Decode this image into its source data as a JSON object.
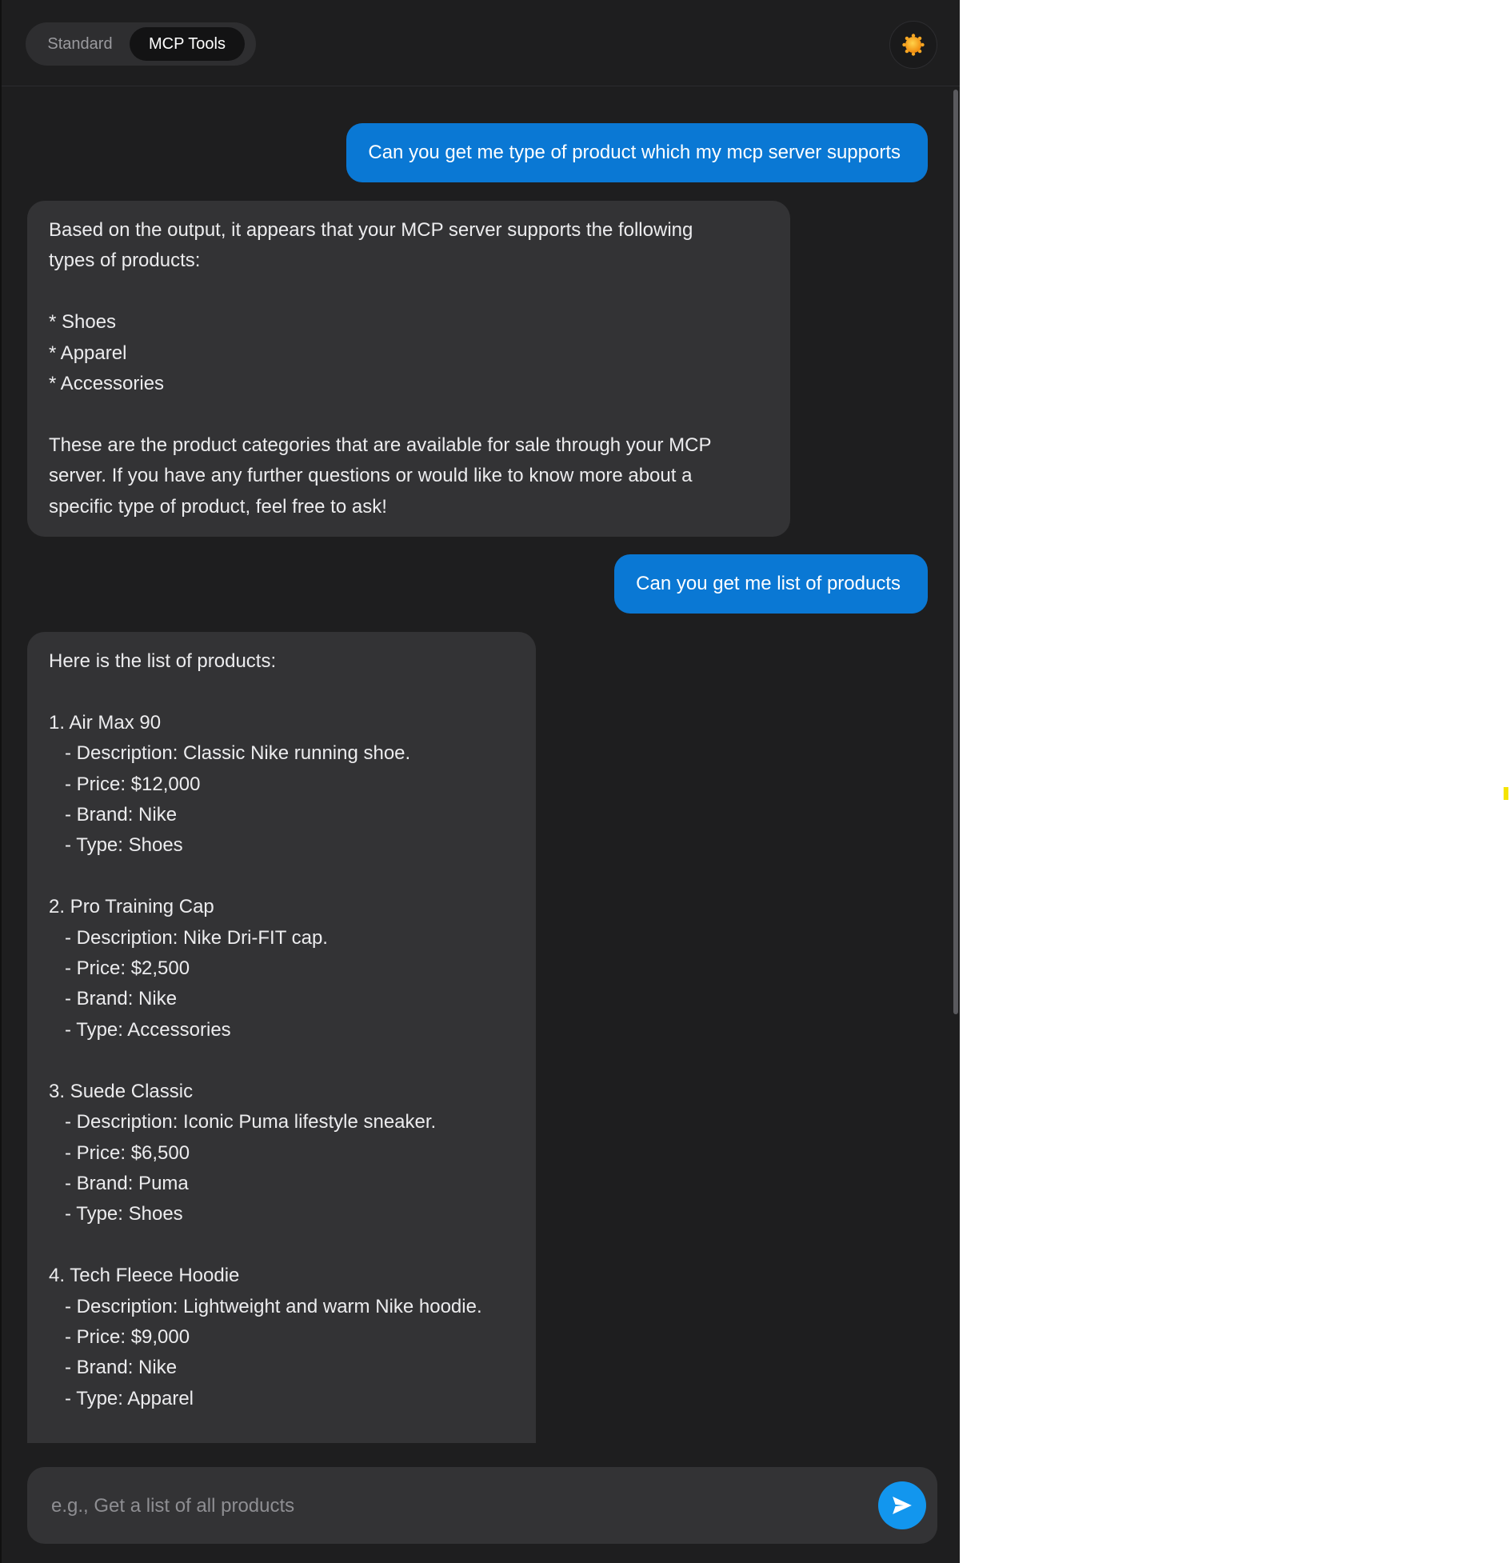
{
  "header": {
    "tabs": [
      {
        "label": "Standard",
        "active": false
      },
      {
        "label": "MCP Tools",
        "active": true
      }
    ],
    "theme_icon": "sun-icon",
    "accent_color": "#f5a623"
  },
  "messages": [
    {
      "role": "user",
      "text": "Can you get me type of product which my mcp server supports"
    },
    {
      "role": "assistant",
      "text": "Based on the output, it appears that your MCP server supports the following\ntypes of products:\n\n* Shoes\n* Apparel\n* Accessories\n\nThese are the product categories that are available for sale through your MCP\nserver. If you have any further questions or would like to know more about a\nspecific type of product, feel free to ask!"
    },
    {
      "role": "user",
      "text": "Can you get me list of products"
    },
    {
      "role": "assistant",
      "text": "Here is the list of products:\n\n1. Air Max 90\n   - Description: Classic Nike running shoe.\n   - Price: $12,000\n   - Brand: Nike\n   - Type: Shoes\n\n2. Pro Training Cap\n   - Description: Nike Dri-FIT cap.\n   - Price: $2,500\n   - Brand: Nike\n   - Type: Accessories\n\n3. Suede Classic\n   - Description: Iconic Puma lifestyle sneaker.\n   - Price: $6,500\n   - Brand: Puma\n   - Type: Shoes\n\n4. Tech Fleece Hoodie\n   - Description: Lightweight and warm Nike hoodie.\n   - Price: $9,000\n   - Brand: Nike\n   - Type: Apparel"
    }
  ],
  "composer": {
    "placeholder": "e.g., Get a list of all products",
    "value": "",
    "send_icon": "send-icon",
    "send_color": "#1296ee"
  },
  "colors": {
    "background": "#1e1e1f",
    "user_bubble": "#0a78d4",
    "assistant_bubble": "#333335"
  }
}
